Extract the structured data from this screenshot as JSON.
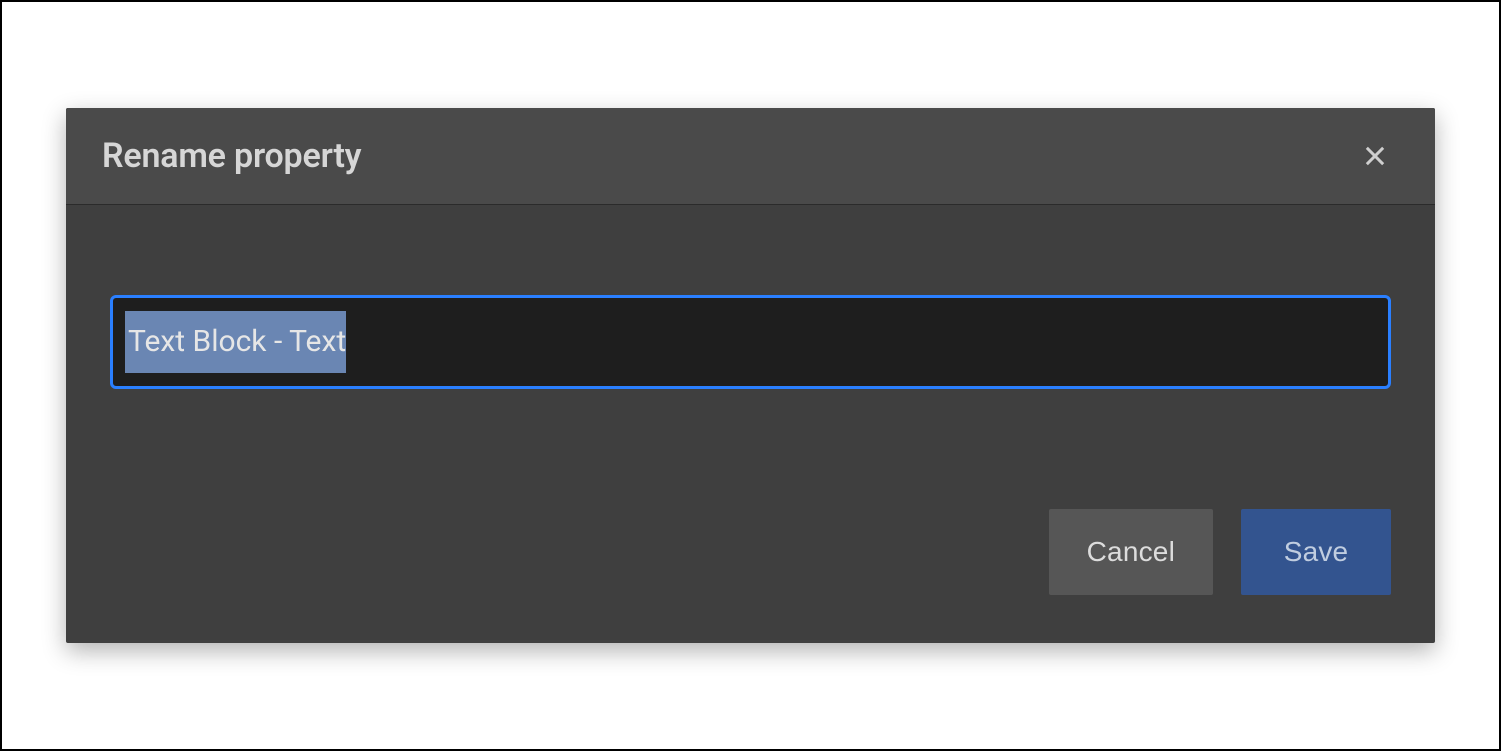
{
  "dialog": {
    "title": "Rename property",
    "input_value": "Text Block - Text",
    "cancel_label": "Cancel",
    "save_label": "Save"
  }
}
